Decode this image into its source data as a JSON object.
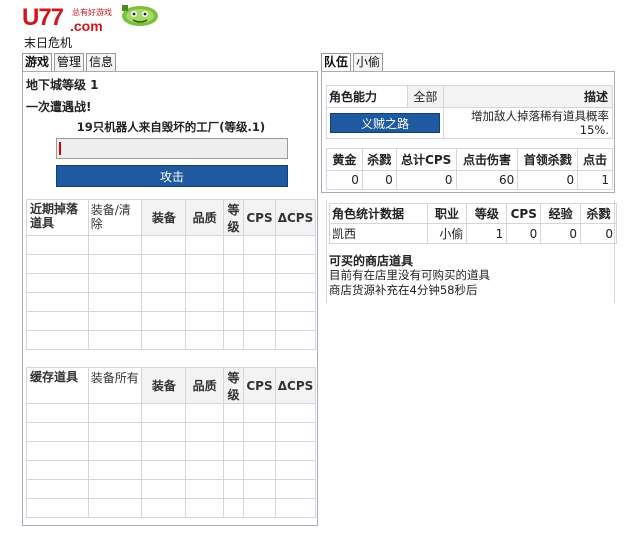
{
  "header": {
    "logo_main": "U77",
    "logo_com": ".com",
    "logo_slogan": "总有好游戏",
    "game_title": "末日危机"
  },
  "left_tabs": [
    {
      "label": "游戏",
      "active": true
    },
    {
      "label": "管理",
      "active": false
    },
    {
      "label": "信息",
      "active": false
    }
  ],
  "right_tabs": [
    {
      "label": "队伍",
      "active": true
    },
    {
      "label": "小偷",
      "active": false
    }
  ],
  "battle": {
    "dungeon_level": "地下城等级 1",
    "encounter": "一次遭遇战!",
    "enemy": "19只机器人来自毁坏的工厂(等级.1)",
    "input_value": "",
    "attack_label": "攻击"
  },
  "recent_drops": {
    "title": "近期掉落道具",
    "action": "装备/清除",
    "columns": [
      "装备",
      "品质",
      "等级",
      "CPS",
      "ΔCPS"
    ],
    "rows": 6
  },
  "stored_items": {
    "title": "缓存道具",
    "action": "装备所有",
    "columns": [
      "装备",
      "品质",
      "等级",
      "CPS",
      "ΔCPS"
    ],
    "rows": 6
  },
  "ability": {
    "label": "角色能力",
    "all_label": "全部",
    "desc_header": "描述",
    "skill_button": "义贼之路",
    "skill_desc": "增加敌人掉落稀有道具概率15%."
  },
  "gold_stats": {
    "headers": [
      "黄金",
      "杀戮",
      "总计CPS",
      "点击伤害",
      "首领杀戮",
      "点击"
    ],
    "values": [
      "0",
      "0",
      "0",
      "60",
      "0",
      "1"
    ]
  },
  "char_stats": {
    "headers": [
      "角色统计数据",
      "职业",
      "等级",
      "CPS",
      "经验",
      "杀戮"
    ],
    "row": [
      "凯西",
      "小偷",
      "1",
      "0",
      "0",
      "0"
    ]
  },
  "shop": {
    "title": "可买的商店道具",
    "line1": "目前有在店里没有可购买的道具",
    "line2": "商店货源补充在4分钟58秒后"
  },
  "colors": {
    "button_blue": "#1f5aa0",
    "logo_red": "#d2151d"
  }
}
